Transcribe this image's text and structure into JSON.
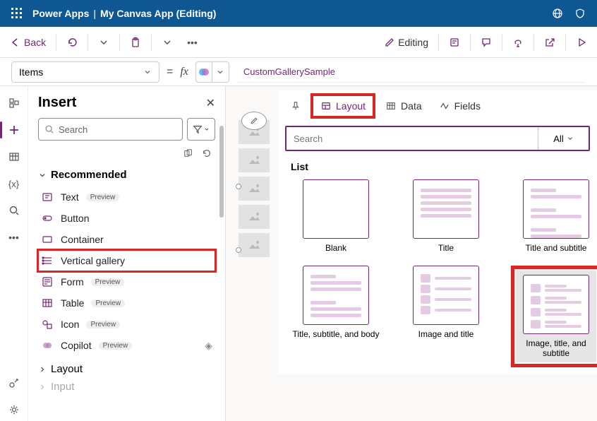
{
  "topbar": {
    "product": "Power Apps",
    "app_title": "My Canvas App (Editing)"
  },
  "cmdbar": {
    "back": "Back",
    "editing": "Editing"
  },
  "formula": {
    "property": "Items",
    "value": "CustomGallerySample"
  },
  "insert": {
    "title": "Insert",
    "search_placeholder": "Search",
    "section": "Recommended",
    "items": [
      {
        "label": "Text",
        "preview": true
      },
      {
        "label": "Button",
        "preview": false
      },
      {
        "label": "Container",
        "preview": false
      },
      {
        "label": "Vertical gallery",
        "preview": false,
        "highlight": true
      },
      {
        "label": "Form",
        "preview": true
      },
      {
        "label": "Table",
        "preview": true
      },
      {
        "label": "Icon",
        "preview": true
      },
      {
        "label": "Copilot",
        "preview": true,
        "diamond": true
      }
    ],
    "preview_badge": "Preview",
    "layout_section": "Layout",
    "input_section": "Input"
  },
  "flyout": {
    "tabs": {
      "layout": "Layout",
      "data": "Data",
      "fields": "Fields"
    },
    "search_placeholder": "Search",
    "all": "All",
    "list_label": "List",
    "layouts": [
      "Blank",
      "Title",
      "Title and subtitle",
      "Title, subtitle, and body",
      "Image and title",
      "Image, title, and subtitle"
    ]
  }
}
